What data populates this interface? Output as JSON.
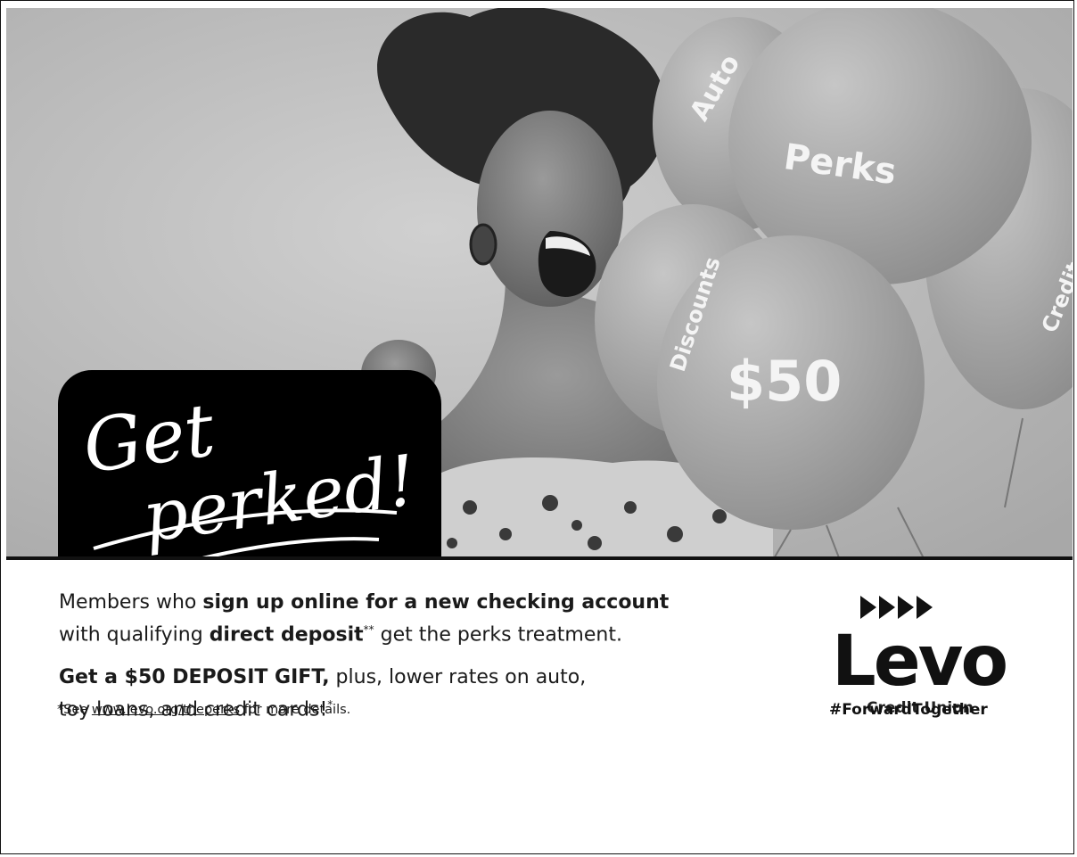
{
  "hero": {
    "balloons": [
      "Auto",
      "Perks",
      "Credit Card",
      "Discounts",
      "$50"
    ],
    "headline_line1": "Get",
    "headline_line2": "perked!"
  },
  "body": {
    "p1_a": "Members who ",
    "p1_b": "sign up online for a new checking account",
    "p1_c": "with qualifying ",
    "p1_d": "direct deposit",
    "p1_e": "**",
    "p1_f": " get the perks treatment.",
    "p2_a": "Get a $50 DEPOSIT GIFT,",
    "p2_b": " plus, lower rates on auto,",
    "p2_c": "toy loans, and credit cards!",
    "p2_d": "*"
  },
  "footnote": {
    "prefix": "*See ",
    "link": "www.levo.org/theperks",
    "suffix": " for more details."
  },
  "logo": {
    "name": "Levo",
    "sub": "Credit Union"
  },
  "hashtag": "#ForwardTogether"
}
